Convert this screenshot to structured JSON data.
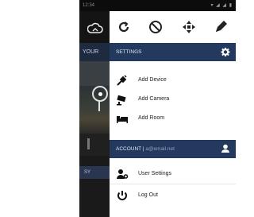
{
  "status_bar": {
    "time": "12:34",
    "icons": "▾ ◢ ◢ ▮"
  },
  "left_strip": {
    "tab_label": "YOUR",
    "bottom_label": "SY"
  },
  "toolbar": {
    "icons": [
      "refresh-icon",
      "block-icon",
      "move-icon",
      "edit-icon"
    ]
  },
  "settings": {
    "header": "SETTINGS",
    "items": [
      {
        "label": "Add Device",
        "icon": "plug-icon"
      },
      {
        "label": "Add Camera",
        "icon": "camera-icon"
      },
      {
        "label": "Add Room",
        "icon": "bed-icon"
      }
    ]
  },
  "account": {
    "header_prefix": "ACCOUNT |",
    "header_value": "a@email.net",
    "items": [
      {
        "label": "User Settings",
        "icon": "user-settings-icon"
      },
      {
        "label": "Log Out",
        "icon": "power-icon"
      }
    ]
  },
  "colors": {
    "header_bg": "#233a5e",
    "header_text": "#dfe6f2"
  }
}
